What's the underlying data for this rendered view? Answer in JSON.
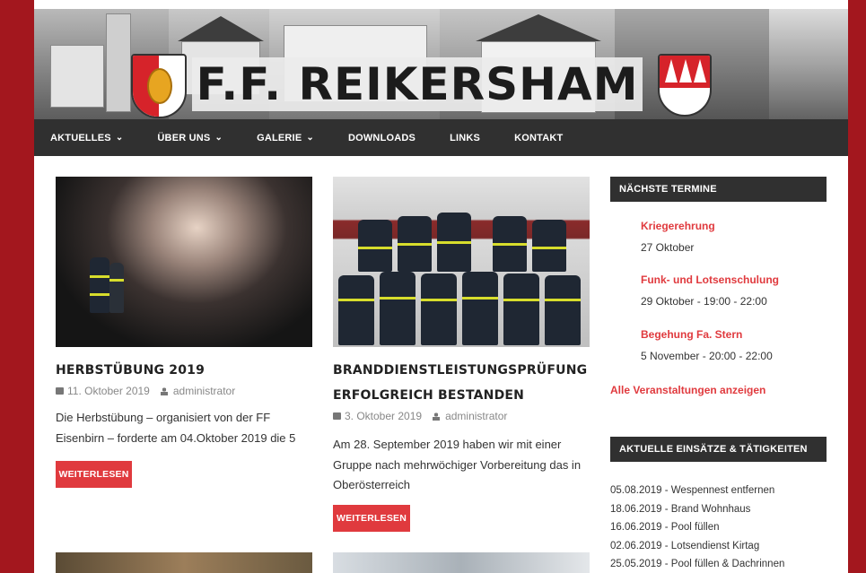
{
  "header": {
    "site_title": "F.F. REIKERSHAM"
  },
  "nav": {
    "items": [
      {
        "label": "AKTUELLES",
        "dropdown": true
      },
      {
        "label": "ÜBER UNS",
        "dropdown": true
      },
      {
        "label": "GALERIE",
        "dropdown": true
      },
      {
        "label": "DOWNLOADS",
        "dropdown": false
      },
      {
        "label": "LINKS",
        "dropdown": false
      },
      {
        "label": "KONTAKT",
        "dropdown": false
      }
    ],
    "caret": "⌄"
  },
  "posts": [
    {
      "title": "HERBSTÜBUNG 2019",
      "date": "11. Oktober 2019",
      "author": "administrator",
      "excerpt": "Die Herbstübung – organisiert von der FF Eisenbirn – forderte am 04.Oktober 2019 die 5",
      "button": "WEITERLESEN"
    },
    {
      "title_line1": "BRANDDIENSTLEISTUNGSPRÜFUNG",
      "title_line2": "ERFOLGREICH BESTANDEN",
      "date": "3. Oktober 2019",
      "author": "administrator",
      "excerpt": "Am 28. September 2019 haben wir mit einer Gruppe nach mehrwöchiger Vorbereitung das in  Oberösterreich",
      "button": "WEITERLESEN"
    }
  ],
  "sidebar": {
    "events_title": "NÄCHSTE TERMINE",
    "events": [
      {
        "title": "Kriegerehrung",
        "date": "27 Oktober"
      },
      {
        "title": "Funk- und Lotsenschulung",
        "date": "29 Oktober - 19:00 - 22:00"
      },
      {
        "title": "Begehung Fa. Stern",
        "date": "5 November - 20:00 - 22:00"
      }
    ],
    "all_events_link": "Alle Veranstaltungen anzeigen",
    "operations_title": "AKTUELLE EINSÄTZE & TÄTIGKEITEN",
    "operations": [
      "05.08.2019 - Wespennest entfernen",
      "18.06.2019 - Brand Wohnhaus",
      "16.06.2019 - Pool füllen",
      "02.06.2019 - Lotsendienst Kirtag",
      "25.05.2019 - Pool füllen & Dachrinnen"
    ]
  },
  "colors": {
    "background": "#a3171e",
    "accent": "#e03a3e",
    "nav": "#303030"
  },
  "icons": {
    "calendar": "calendar-icon",
    "user": "user-icon",
    "dropdown": "chevron-down-icon"
  }
}
